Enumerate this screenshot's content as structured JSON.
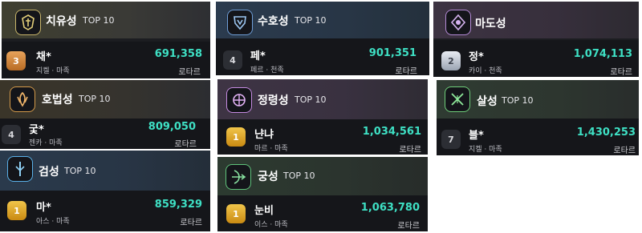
{
  "colors": {
    "score": "#3ee0c4"
  },
  "cards": {
    "healer": {
      "class_name": "치유성",
      "top_label": "TOP 10",
      "rank": "3",
      "player": "채*",
      "sub": "지켈 · 마족",
      "score": "691,358",
      "server": "로타르",
      "icon": "healer-emblem-icon"
    },
    "guardian": {
      "class_name": "수호성",
      "top_label": "TOP 10",
      "rank": "4",
      "player": "페*",
      "sub": "페르 · 천족",
      "score": "901,351",
      "server": "로타르",
      "icon": "guardian-emblem-icon"
    },
    "sorcerer": {
      "class_name": "마도성",
      "top_label": "TOP 10",
      "rank": "2",
      "player": "정*",
      "sub": "카이 · 천족",
      "score": "1,074,113",
      "server": "로타르",
      "icon": "sorcerer-emblem-icon"
    },
    "templar": {
      "class_name": "호법성",
      "top_label": "TOP 10",
      "rank": "4",
      "player": "궃*",
      "sub": "젠카 · 마족",
      "score": "809,050",
      "server": "로타르",
      "icon": "templar-emblem-icon"
    },
    "spirit": {
      "class_name": "정령성",
      "top_label": "TOP 10",
      "rank": "1",
      "player": "냔냐",
      "sub": "마르 · 마족",
      "score": "1,034,561",
      "server": "로타르",
      "icon": "spiritmaster-emblem-icon"
    },
    "assassin": {
      "class_name": "살성",
      "top_label": "TOP 10",
      "rank": "7",
      "player": "블*",
      "sub": "지켈 · 마족",
      "score": "1,430,253",
      "server": "로타르",
      "icon": "assassin-emblem-icon"
    },
    "gladiator": {
      "class_name": "검성",
      "top_label": "TOP 10",
      "rank": "1",
      "player": "마*",
      "sub": "아스 · 마족",
      "score": "859,329",
      "server": "로타르",
      "icon": "gladiator-emblem-icon"
    },
    "ranger": {
      "class_name": "궁성",
      "top_label": "TOP 10",
      "rank": "1",
      "player": "눈비",
      "sub": "이스 · 마족",
      "score": "1,063,780",
      "server": "로타르",
      "icon": "ranger-emblem-icon"
    }
  }
}
